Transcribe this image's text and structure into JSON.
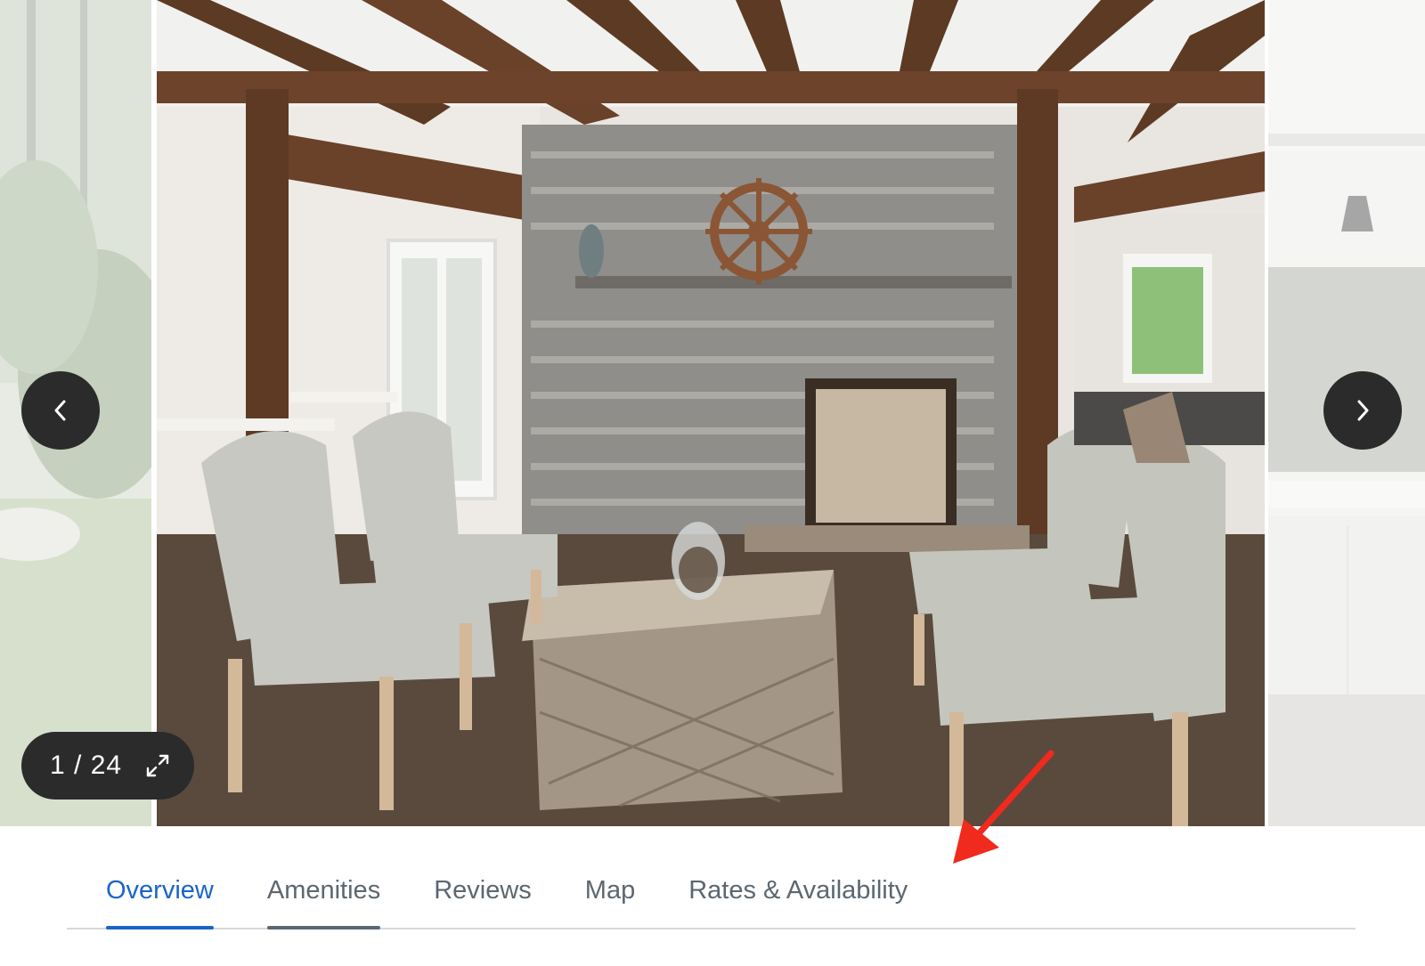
{
  "gallery": {
    "current_index": 1,
    "total": 24,
    "counter_text": "1 / 24",
    "prev_icon": "chevron-left-icon",
    "next_icon": "chevron-right-icon",
    "expand_icon": "expand-icon"
  },
  "tabs": [
    {
      "label": "Overview",
      "state": "active"
    },
    {
      "label": "Amenities",
      "state": "hover"
    },
    {
      "label": "Reviews",
      "state": "normal"
    },
    {
      "label": "Map",
      "state": "normal"
    },
    {
      "label": "Rates & Availability",
      "state": "normal"
    }
  ],
  "colors": {
    "accent": "#1a64c8",
    "tab_text": "#5c6770",
    "overlay_button": "#2b2b2b",
    "annotation_arrow": "#f02a1c"
  }
}
